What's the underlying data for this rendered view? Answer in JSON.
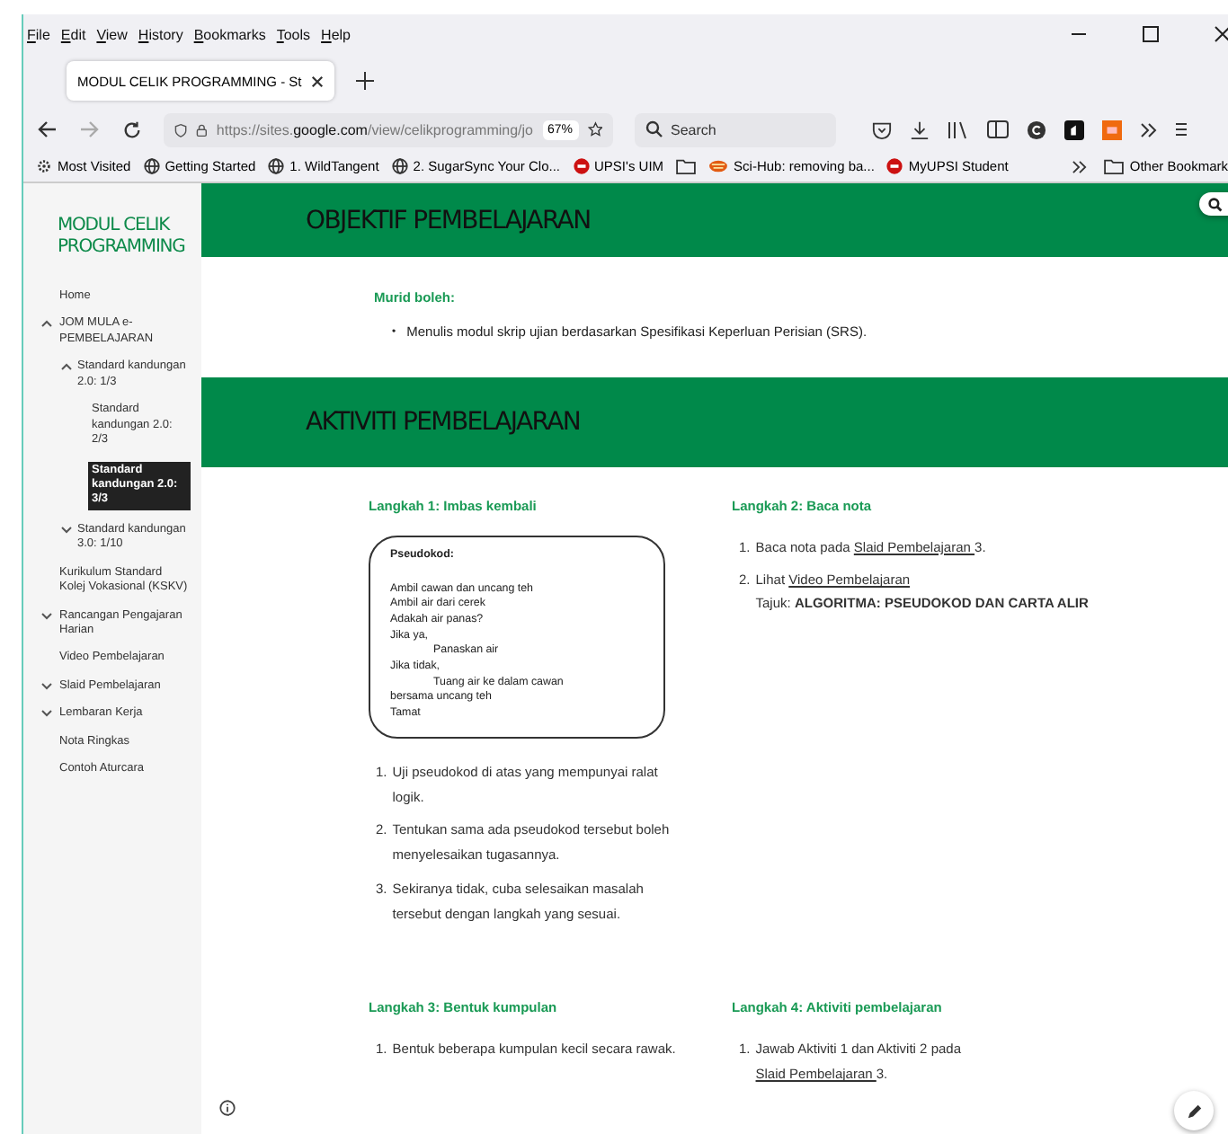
{
  "menu": [
    "File",
    "Edit",
    "View",
    "History",
    "Bookmarks",
    "Tools",
    "Help"
  ],
  "tabs": [
    {
      "label": "MODUL CELIK PROGRAMMING - St",
      "selected": true
    }
  ],
  "address": {
    "url_pre": "https://sites.",
    "url_host": "google.com",
    "url_post": "/view/celikprogramming/jo",
    "zoom": "67%"
  },
  "search": {
    "placeholder": "Search"
  },
  "bookmarks": [
    {
      "kind": "gear",
      "label": "Most Visited"
    },
    {
      "kind": "globe",
      "label": "Getting Started"
    },
    {
      "kind": "globe",
      "label": "1. WildTangent"
    },
    {
      "kind": "globe",
      "label": "2. SugarSync Your Clo..."
    },
    {
      "kind": "badge",
      "label": "UPSI's UIM"
    },
    {
      "kind": "folder"
    },
    {
      "kind": "hub",
      "label": "Sci-Hub: removing ba..."
    },
    {
      "kind": "badge",
      "label": "MyUPSI Student"
    }
  ],
  "other_bookmarks": "Other Bookmark",
  "site_title": "MODUL CELIK PROGRAMMING",
  "nav": [
    {
      "label": "Home",
      "selected": false
    },
    {
      "label": "JOM MULA e-PEMBELAJARAN",
      "selected": false,
      "expanded": true,
      "children": [
        {
          "label": "Standard kandungan 2.0: 1/3",
          "selected": false,
          "expanded": true,
          "children": [
            {
              "label": "Standard kandungan 2.0: 2/3",
              "selected": false
            },
            {
              "label": "Standard kandungan 2.0: 3/3",
              "selected": true
            }
          ]
        },
        {
          "label": "Standard kandungan 3.0: 1/10",
          "selected": false,
          "expanded": false
        }
      ]
    },
    {
      "label": "Kurikulum Standard Kolej Vokasional (KSKV)",
      "selected": false
    },
    {
      "label": "Rancangan Pengajaran Harian",
      "selected": false,
      "expanded": false
    },
    {
      "label": "Video Pembelajaran",
      "selected": false
    },
    {
      "label": "Slaid Pembelajaran",
      "selected": false,
      "expanded": false
    },
    {
      "label": "Lembaran Kerja",
      "selected": false,
      "expanded": false
    },
    {
      "label": "Nota Ringkas",
      "selected": false
    },
    {
      "label": "Contoh Aturcara",
      "selected": false
    }
  ],
  "objective": {
    "heading": "OBJEKTIF PEMBELAJARAN",
    "subheading": "Murid boleh:",
    "bullets": [
      {
        "marker": "•",
        "text": "Menulis modul skrip ujian berdasarkan Spesifikasi Keperluan Perisian (SRS)."
      }
    ]
  },
  "activity": {
    "heading": "AKTIVITI PEMBELAJARAN"
  },
  "steps": [
    {
      "heading": "Langkah 1: Imbas kembali",
      "pseudocode": {
        "title": "Pseudokod:",
        "lines": [
          {
            "text": "Ambil cawan dan uncang teh"
          },
          {
            "text": "Ambil air dari cerek"
          },
          {
            "text": "Adakah air panas?"
          },
          {
            "text": "Jika ya,",
            "children": [
              {
                "text": "Panaskan air"
              }
            ]
          },
          {
            "text": "Jika tidak,",
            "children": [
              {
                "text": "Tuang air ke dalam cawan"
              }
            ]
          },
          {
            "text": "bersama uncang teh"
          },
          {
            "text": "Tamat"
          }
        ]
      },
      "items": [
        {
          "number": "1.",
          "parts": [
            {
              "kind": "text",
              "text": "Uji pseudokod di atas yang mempunyai ralat logik."
            }
          ]
        },
        {
          "number": "2.",
          "parts": [
            {
              "kind": "text",
              "text": "Tentukan sama ada pseudokod tersebut boleh menyelesaikan tugasannya."
            }
          ]
        },
        {
          "number": "3.",
          "parts": [
            {
              "kind": "text",
              "text": "Sekiranya tidak, cuba selesaikan masalah tersebut dengan langkah yang sesuai."
            }
          ]
        }
      ]
    },
    {
      "heading": "Langkah 2: Baca nota",
      "items": [
        {
          "number": "1.",
          "parts": [
            {
              "kind": "text",
              "text": "Baca nota pada "
            },
            {
              "kind": "link",
              "text": "Slaid Pembelajaran "
            },
            {
              "kind": "text",
              "text": "3."
            }
          ]
        },
        {
          "number": "2.",
          "parts": [
            {
              "kind": "text",
              "text": "Lihat "
            },
            {
              "kind": "link",
              "text": "Video Pembelajaran"
            }
          ],
          "note": "Tajuk: **ALGORITMA: PSEUDOKOD DAN CARTA   ALIR**"
        }
      ]
    },
    {
      "heading": "Langkah 3: Bentuk kumpulan",
      "items": [
        {
          "number": "1.",
          "parts": [
            {
              "kind": "text",
              "text": "Bentuk beberapa kumpulan kecil secara rawak."
            }
          ]
        }
      ]
    },
    {
      "heading": "Langkah 4: Aktiviti pembelajaran",
      "items": [
        {
          "number": "1.",
          "parts": [
            {
              "kind": "text",
              "text": "Jawab Aktiviti 1 dan Aktiviti 2 pada "
            },
            {
              "kind": "link",
              "text": "Slaid Pembelajaran "
            },
            {
              "kind": "text",
              "text": "3."
            }
          ]
        }
      ]
    }
  ]
}
